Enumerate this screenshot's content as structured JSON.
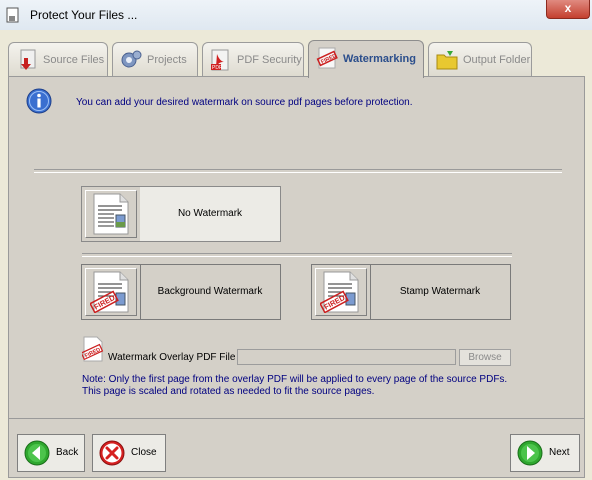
{
  "window": {
    "title": "Protect Your Files ...",
    "close_glyph": "x"
  },
  "tabs": [
    {
      "label": "Source Files",
      "icon": "source-files-icon"
    },
    {
      "label": "Projects",
      "icon": "projects-icon"
    },
    {
      "label": "PDF Security",
      "icon": "pdf-security-icon"
    },
    {
      "label": "Watermarking",
      "icon": "watermark-stamp-icon",
      "active": true
    },
    {
      "label": "Output Folder",
      "icon": "folder-icon"
    }
  ],
  "info": {
    "text": "You can add your desired watermark on source pdf pages before protection."
  },
  "options": {
    "no_watermark": "No Watermark",
    "background_watermark": "Background Watermark",
    "stamp_watermark": "Stamp Watermark"
  },
  "overlay": {
    "label": "Watermark Overlay PDF File :",
    "value": "",
    "browse_label": "Browse"
  },
  "note": "Note: Only the first page from the overlay PDF will be applied to every page of the source PDFs. This page is scaled and rotated as needed to fit the source pages.",
  "buttons": {
    "back": "Back",
    "close": "Close",
    "next": "Next"
  },
  "colors": {
    "info_text": "#000080",
    "active_tab": "#2b4e8c",
    "nav_green": "#2fa82f",
    "close_red": "#d62020"
  }
}
